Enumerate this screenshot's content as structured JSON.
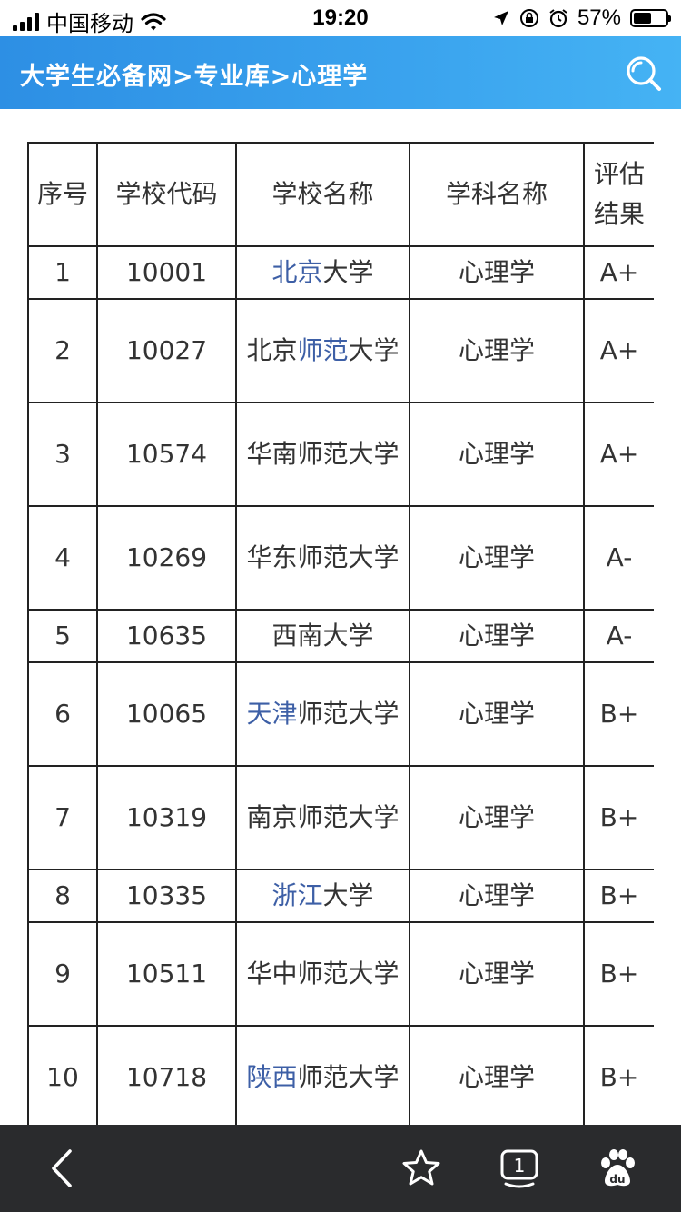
{
  "status_bar": {
    "carrier": "中国移动",
    "time": "19:20",
    "battery": "57%"
  },
  "nav": {
    "breadcrumb": "大学生必备网>专业库>心理学"
  },
  "table": {
    "headers": [
      "序号",
      "学校代码",
      "学校名称",
      "学科名称",
      "评估结果"
    ],
    "header_grade_lines": [
      "评估",
      "结果"
    ],
    "rows": [
      {
        "idx": "1",
        "code": "10001",
        "name_link": "北京",
        "name_rest": "大学",
        "name_lines": 1,
        "subject": "心理学",
        "grade": "A+"
      },
      {
        "idx": "2",
        "code": "10027",
        "name_pre": "北京",
        "name_link": "师范",
        "name_rest": "大学",
        "name_lines": 2,
        "subject": "心理学",
        "grade": "A+"
      },
      {
        "idx": "3",
        "code": "10574",
        "name_rest": "华南师范大学",
        "name_lines": 2,
        "subject": "心理学",
        "grade": "A+"
      },
      {
        "idx": "4",
        "code": "10269",
        "name_rest": "华东师范大学",
        "name_lines": 2,
        "subject": "心理学",
        "grade": "A-"
      },
      {
        "idx": "5",
        "code": "10635",
        "name_rest": "西南大学",
        "name_lines": 1,
        "subject": "心理学",
        "grade": "A-"
      },
      {
        "idx": "6",
        "code": "10065",
        "name_link": "天津",
        "name_rest": "师范大学",
        "name_lines": 2,
        "subject": "心理学",
        "grade": "B+"
      },
      {
        "idx": "7",
        "code": "10319",
        "name_rest": "南京师范大学",
        "name_lines": 2,
        "subject": "心理学",
        "grade": "B+"
      },
      {
        "idx": "8",
        "code": "10335",
        "name_link": "浙江",
        "name_rest": "大学",
        "name_lines": 1,
        "subject": "心理学",
        "grade": "B+"
      },
      {
        "idx": "9",
        "code": "10511",
        "name_rest": "华中师范大学",
        "name_lines": 2,
        "subject": "心理学",
        "grade": "B+"
      },
      {
        "idx": "10",
        "code": "10718",
        "name_link": "陕西",
        "name_rest": "师范大学",
        "name_lines": 2,
        "subject": "心理学",
        "grade": "B+"
      }
    ]
  },
  "bottom_bar": {
    "tab_count": "1",
    "icons": [
      "back-icon",
      "star-icon",
      "tabs-icon",
      "baidu-paw-icon"
    ]
  },
  "colors": {
    "nav_gradient_start": "#2d8fe4",
    "nav_gradient_end": "#45b3f4",
    "link": "#3d5fa6",
    "bottom_bar": "#2a2b2d"
  }
}
